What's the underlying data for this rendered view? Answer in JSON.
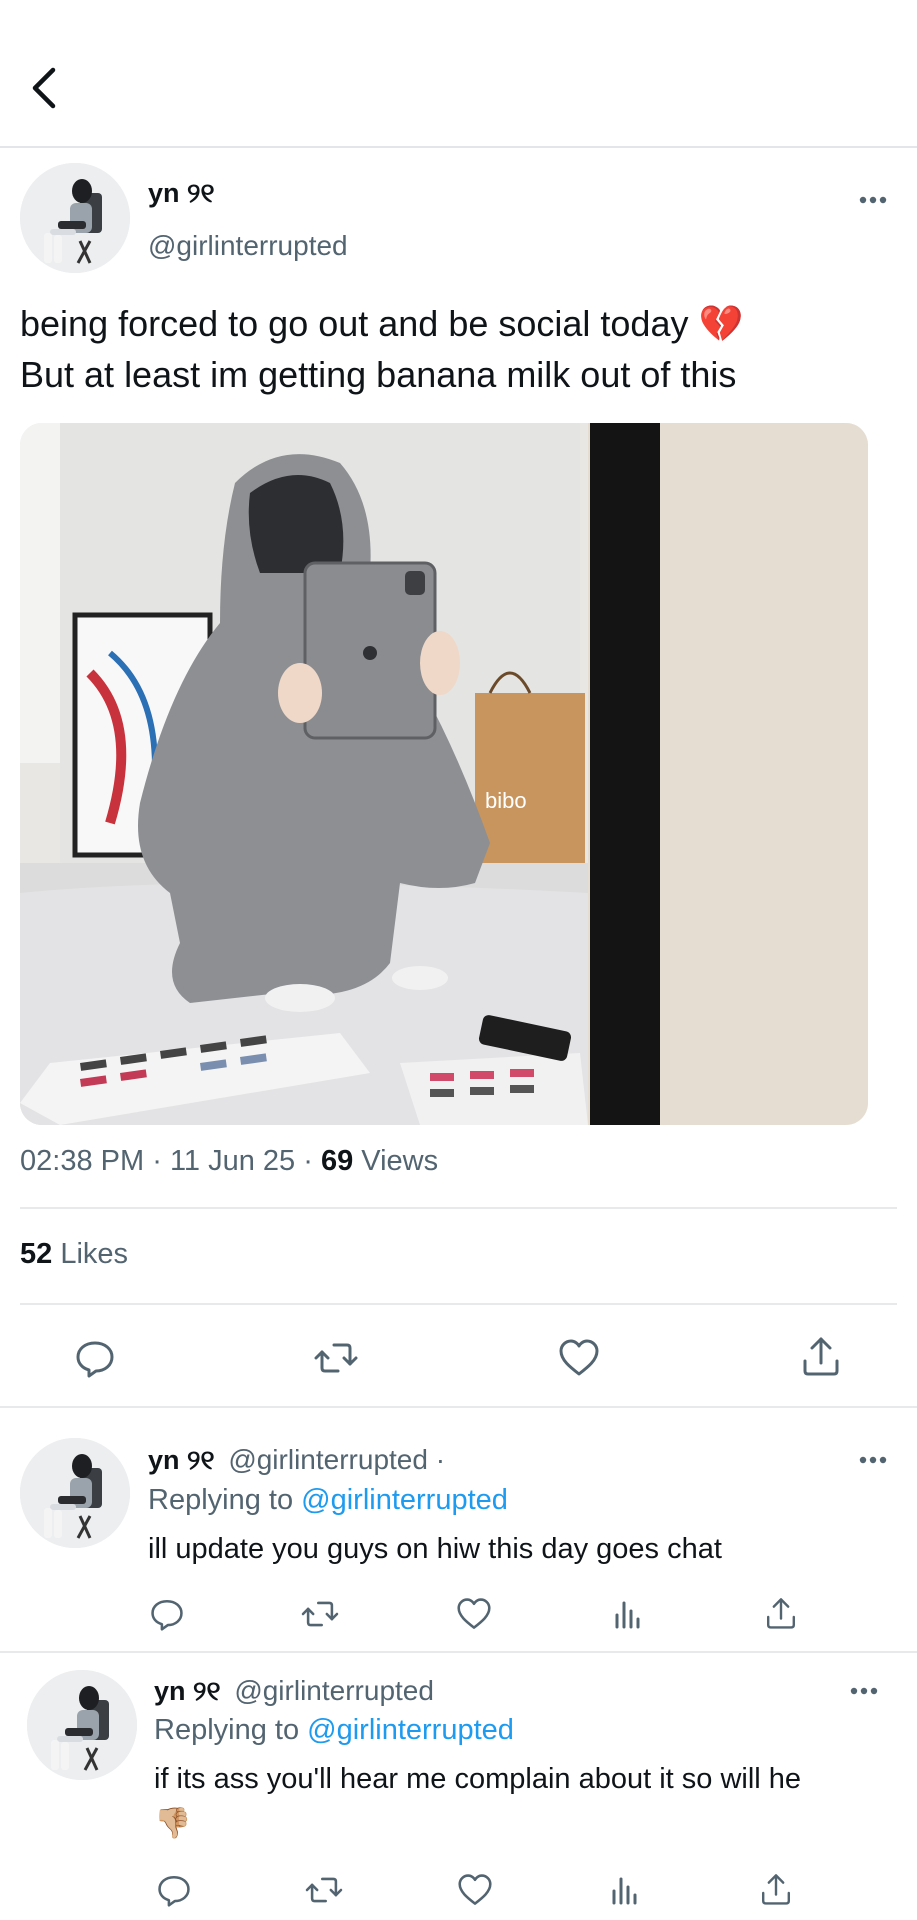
{
  "header": {
    "back_icon": "chevron-left-icon"
  },
  "tweet": {
    "display_name": "yn ୨୧",
    "handle": "@girlinterrupted",
    "text_line1": "being forced to go out and be social today 💔",
    "text_line2": "But at least im getting banana milk out of this",
    "image_text": "bibo",
    "time": "02:38 PM",
    "sep1": "·",
    "date": "11 Jun 25",
    "sep2": "·",
    "views_count": "69",
    "views_label": "Views",
    "likes_count": "52",
    "likes_label": "Likes"
  },
  "replies": [
    {
      "display_name": "yn ୨୧",
      "handle": "@girlinterrupted ·",
      "replying_prefix": "Replying to",
      "replying_to": "@girlinterrupted",
      "text": "ill update you guys on hiw this day goes chat"
    },
    {
      "display_name": "yn ୨୧",
      "handle": "@girlinterrupted",
      "replying_prefix": "Replying to",
      "replying_to": "@girlinterrupted",
      "text": "if its ass you'll hear me complain about it so will he",
      "emoji": "👎🏼"
    }
  ],
  "icons": [
    "chevron-left-icon",
    "more-icon",
    "reply-icon",
    "retweet-icon",
    "like-icon",
    "share-icon",
    "views-icon"
  ],
  "colors": {
    "link": "#1d9bf0",
    "secondary": "#536471",
    "text": "#0f1419",
    "divider": "#e7e9eb"
  }
}
